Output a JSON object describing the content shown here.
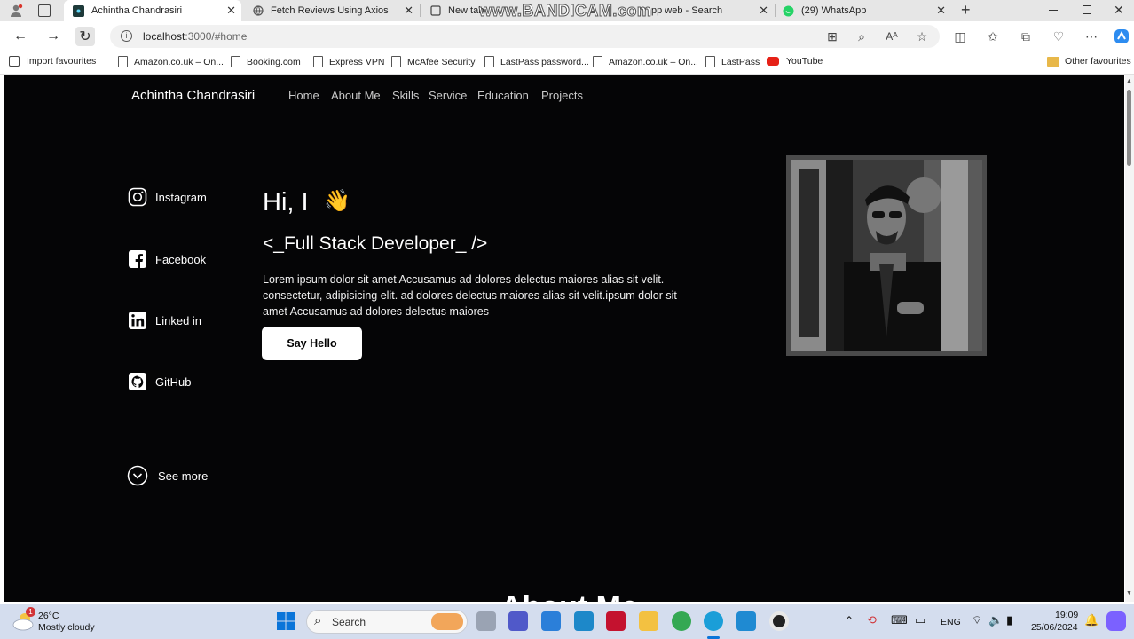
{
  "browser": {
    "tabs": [
      {
        "title": "Achintha Chandrasiri",
        "active": true
      },
      {
        "title": "Fetch Reviews Using Axios",
        "active": false
      },
      {
        "title": "New tab",
        "active": false
      },
      {
        "title": "pp web - Search",
        "active": false
      },
      {
        "title": "(29) WhatsApp",
        "active": false
      }
    ],
    "new_tab_label": "+",
    "url_host": "localhost",
    "url_path": ":3000/#home",
    "watermark": "www.BANDICAM.com",
    "bookmarks": [
      "Import favourites",
      "Amazon.co.uk – On...",
      "Booking.com",
      "Express VPN",
      "McAfee Security",
      "LastPass password...",
      "Amazon.co.uk – On...",
      "LastPass",
      "YouTube"
    ],
    "other_favourites": "Other favourites"
  },
  "site": {
    "brand": "Achintha Chandrasiri",
    "nav": [
      "Home",
      "About Me",
      "Skills",
      "Service",
      "Education",
      "Projects"
    ],
    "socials": [
      "Instagram",
      "Facebook",
      "Linked in",
      "GitHub"
    ],
    "greeting": "Hi, I",
    "wave": "👋",
    "role": "<_Full Stack Developer_ />",
    "description": "Lorem ipsum dolor sit amet Accusamus ad dolores delectus maiores alias sit velit. consectetur, adipisicing elit. ad dolores delectus maiores alias sit velit.ipsum dolor sit amet Accusamus ad dolores delectus maiores",
    "cta": "Say Hello",
    "see_more": "See more",
    "next_section_peek": "About Me"
  },
  "taskbar": {
    "weather_temp": "26°C",
    "weather_desc": "Mostly cloudy",
    "weather_badge": "1",
    "search_placeholder": "Search",
    "lang": "ENG",
    "time": "19:09",
    "date": "25/06/2024"
  },
  "colors": {
    "page_bg": "#050506",
    "tabstrip": "#e6e6e6",
    "taskbar": "#d4ddee"
  }
}
